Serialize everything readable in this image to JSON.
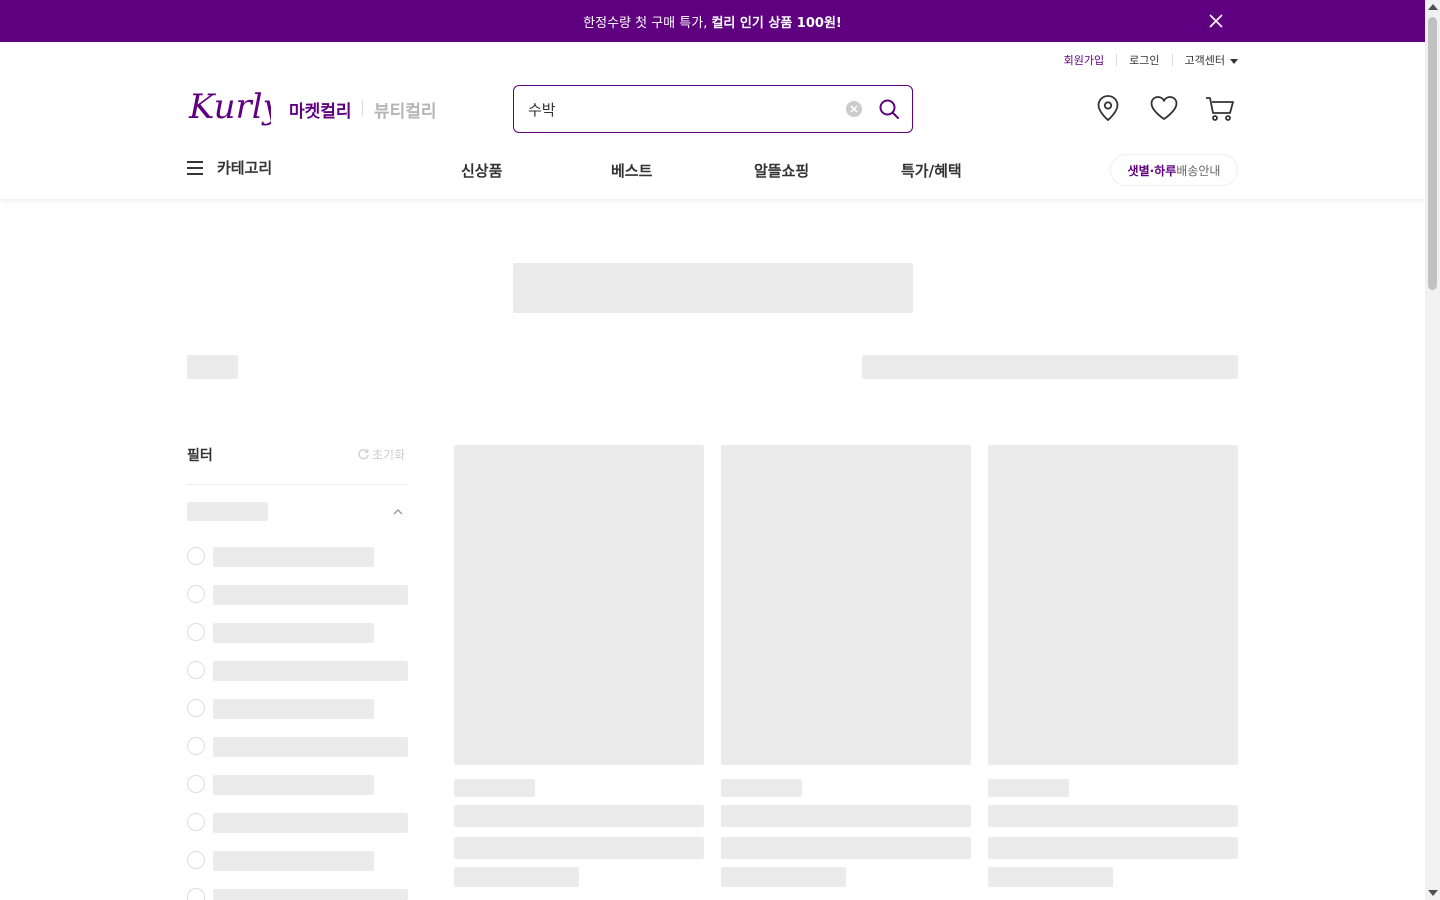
{
  "promo": {
    "text_normal": "한정수량 첫 구매 특가, ",
    "text_bold": "컬리 인기 상품 100원!"
  },
  "util_menu": {
    "signup": "회원가입",
    "login": "로그인",
    "customer_center": "고객센터"
  },
  "header": {
    "logo_text": "Kurly",
    "market_tab": "마켓컬리",
    "beauty_tab": "뷰티컬리",
    "brand_color": "#5f0080"
  },
  "search": {
    "value": "수박"
  },
  "gnb": {
    "category": "카테고리",
    "menus": [
      "신상품",
      "베스트",
      "알뜰쇼핑",
      "특가/혜택"
    ],
    "delivery_bold": "샛별·하루",
    "delivery_rest": " 배송안내"
  },
  "filter": {
    "title": "필터",
    "reset": "초기화"
  }
}
